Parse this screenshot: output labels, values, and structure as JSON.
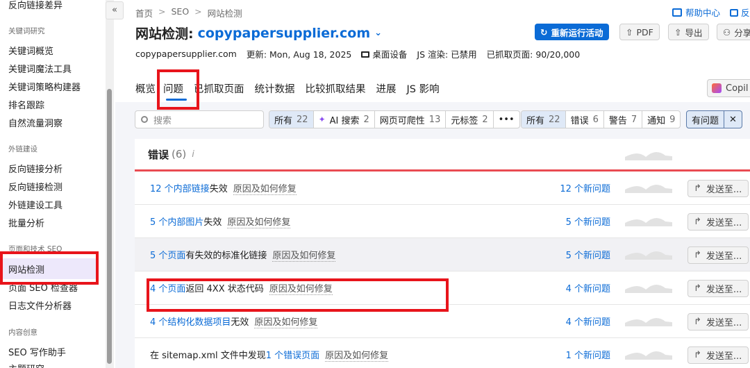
{
  "sidebar": {
    "top_item": "反向链接差异",
    "sections": [
      {
        "heading": "关键词研究",
        "items": [
          "关键词概览",
          "关键词魔法工具",
          "关键词策略构建器",
          "排名跟踪",
          "自然流量洞察"
        ]
      },
      {
        "heading": "外链建设",
        "items": [
          "反向链接分析",
          "反向链接检测",
          "外链建设工具",
          "批量分析"
        ]
      },
      {
        "heading": "页面和技术 SEO",
        "items": [
          "网站检测",
          "页面 SEO 检查器",
          "日志文件分析器"
        ]
      },
      {
        "heading": "内容创意",
        "items": [
          "SEO 写作助手",
          "主题研究"
        ]
      }
    ],
    "active_item": "网站检测",
    "collapse_icon": "«"
  },
  "breadcrumb": [
    "首页",
    "SEO",
    "网站检测"
  ],
  "breadcrumb_sep": ">",
  "header": {
    "title_prefix": "网站检测:",
    "domain": "copypapersupplier.com",
    "domain_chevron": "⌄",
    "help_label": "帮助中心",
    "help_extra": "反",
    "rerun_label": "重新运行活动",
    "pdf_label": "PDF",
    "export_label": "导出",
    "share_label": "分享"
  },
  "meta": {
    "site": "copypapersupplier.com",
    "updated": "更新:  Mon, Aug 18, 2025",
    "device": "桌面设备",
    "js_render": "JS 渲染:  已禁用",
    "pages_crawled": "已抓取页面:  90/20,000"
  },
  "tabs": [
    "概览",
    "问题",
    "已抓取页面",
    "统计数据",
    "比较抓取结果",
    "进展",
    "JS 影响"
  ],
  "active_tab": "问题",
  "copilot_label": "Copil",
  "filters": {
    "search_placeholder": "搜索",
    "category": [
      {
        "label": "所有",
        "count": "22",
        "selected": true
      },
      {
        "label": "AI 搜索",
        "count": "2",
        "icon": "✦"
      },
      {
        "label": "网页可爬性",
        "count": "13"
      },
      {
        "label": "元标签",
        "count": "2"
      },
      {
        "label": "•••",
        "count": ""
      }
    ],
    "severity": [
      {
        "label": "所有",
        "count": "22",
        "selected": true
      },
      {
        "label": "错误",
        "count": "6"
      },
      {
        "label": "警告",
        "count": "7"
      },
      {
        "label": "通知",
        "count": "9"
      }
    ],
    "has_issue_label": "有问题",
    "clear_label": "✕"
  },
  "table": {
    "group_title": "错误",
    "group_count": "(6)",
    "group_info": "i",
    "send_label": "发送至...",
    "why_label": "原因及如何修复",
    "rows": [
      {
        "pre": "",
        "link": "12 个内部链接",
        "post": "失效",
        "new": "12 个新问题"
      },
      {
        "pre": "",
        "link": "5 个内部图片",
        "post": "失效",
        "new": "5 个新问题"
      },
      {
        "pre": "",
        "link": "5 个页面",
        "post": "有失效的标准化链接",
        "new": "5 个新问题"
      },
      {
        "pre": "",
        "link": "4 个页面",
        "post": "返回 4XX 状态代码",
        "new": "4 个新问题"
      },
      {
        "pre": "",
        "link": "4 个结构化数据项目",
        "post": "无效",
        "new": "4 个新问题"
      },
      {
        "pre": "在 sitemap.xml 文件中发现 ",
        "link": "1 个错误页面",
        "post": "",
        "new": "1 个新问题"
      }
    ]
  },
  "colors": {
    "accent": "#0b6bd6",
    "error_line": "#e94b52",
    "highlight": "#e8141b",
    "active_bg": "#ede8fb"
  }
}
